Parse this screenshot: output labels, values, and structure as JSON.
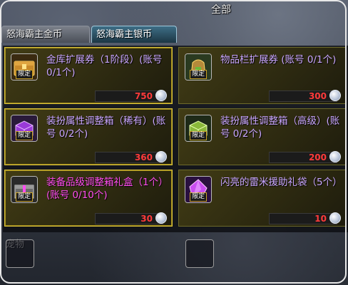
{
  "header": {
    "all_label": "全部"
  },
  "tabs": [
    {
      "label": "怒海霸主金币",
      "active": false
    },
    {
      "label": "怒海霸主银币",
      "active": true
    }
  ],
  "badge_text": "限定",
  "items": [
    {
      "name": "金库扩展券（1阶段）(账号 0/1个)",
      "price": "750",
      "icon": "treasure-chest-icon",
      "highlighted": true,
      "name_color": "#c9a6ff"
    },
    {
      "name": "物品栏扩展券 (账号 0/1个)",
      "price": "300",
      "icon": "backpack-icon",
      "highlighted": false,
      "name_color": "#c9a6ff"
    },
    {
      "name": "装扮属性调整箱（稀有）(账号 0/2个)",
      "price": "360",
      "icon": "purple-box-icon",
      "highlighted": true,
      "name_color": "#c9a6ff"
    },
    {
      "name": "装扮属性调整箱（高级）(账号 0/2个)",
      "price": "200",
      "icon": "green-box-icon",
      "highlighted": false,
      "name_color": "#c9a6ff"
    },
    {
      "name": "装备品级调整箱礼盒（1个）(账号 0/10个)",
      "price": "30",
      "icon": "gift-box-icon",
      "highlighted": true,
      "name_color": "#ff4df0"
    },
    {
      "name": "闪亮的雷米援助礼袋（5个）",
      "price": "10",
      "icon": "crystal-bag-icon",
      "highlighted": false,
      "name_color": "#c9a6ff"
    }
  ],
  "bottom": {
    "label": "宠物"
  }
}
